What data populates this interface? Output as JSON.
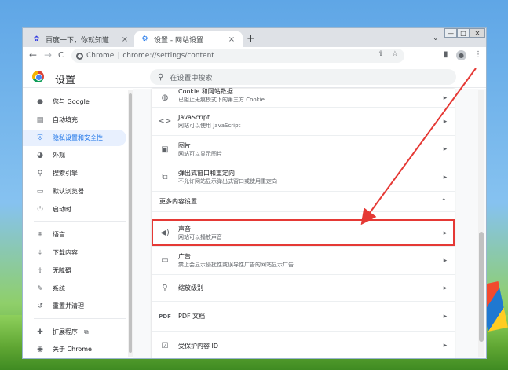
{
  "tabs": [
    {
      "title": "百度一下，你就知道",
      "close": "×"
    },
    {
      "title": "设置 - 网站设置",
      "close": "×"
    }
  ],
  "newtab": "+",
  "window_controls": {
    "minimize": "—",
    "maximize": "□",
    "close": "✕"
  },
  "toolbar": {
    "back": "←",
    "forward": "→",
    "reload": "C",
    "chip": "Chrome",
    "url": "chrome://settings/content"
  },
  "settings": {
    "title": "设置",
    "search_placeholder": "在设置中搜索"
  },
  "sidebar": {
    "items": [
      {
        "label": "您与 Google",
        "icon": "person-icon"
      },
      {
        "label": "自动填充",
        "icon": "clipboard-icon"
      },
      {
        "label": "隐私设置和安全性",
        "icon": "shield-icon"
      },
      {
        "label": "外观",
        "icon": "palette-icon"
      },
      {
        "label": "搜索引擎",
        "icon": "search-icon"
      },
      {
        "label": "默认浏览器",
        "icon": "browser-icon"
      },
      {
        "label": "启动时",
        "icon": "power-icon"
      },
      {
        "label": "语言",
        "icon": "globe-icon"
      },
      {
        "label": "下载内容",
        "icon": "download-icon"
      },
      {
        "label": "无障碍",
        "icon": "accessibility-icon"
      },
      {
        "label": "系统",
        "icon": "wrench-icon"
      },
      {
        "label": "重置并清理",
        "icon": "history-icon"
      },
      {
        "label": "扩展程序",
        "icon": "puzzle-icon"
      },
      {
        "label": "关于 Chrome",
        "icon": "chrome-icon"
      }
    ],
    "active_index": 2
  },
  "content": {
    "rows_top": [
      {
        "title": "Cookie 和网站数据",
        "subtitle": "已阻止无痕模式下的第三方 Cookie",
        "icon": "cookie-icon"
      },
      {
        "title": "JavaScript",
        "subtitle": "网站可以使用 JavaScript",
        "icon": "code-icon"
      },
      {
        "title": "图片",
        "subtitle": "网站可以显示图片",
        "icon": "image-icon"
      },
      {
        "title": "弹出式窗口和重定向",
        "subtitle": "不允许网站显示弹出式窗口或使用重定向",
        "icon": "popup-icon"
      }
    ],
    "section_title": "更多内容设置",
    "rows_more": [
      {
        "title": "声音",
        "subtitle": "网站可以播放声音",
        "icon": "speaker-icon"
      },
      {
        "title": "广告",
        "subtitle": "禁止会显示侵扰性或误导性广告的网站显示广告",
        "icon": "ad-icon"
      },
      {
        "title": "缩放级别",
        "subtitle": "",
        "icon": "zoom-icon"
      },
      {
        "title": "PDF 文档",
        "subtitle": "",
        "icon": "pdf-icon"
      },
      {
        "title": "受保护内容 ID",
        "subtitle": "",
        "icon": "protected-content-icon"
      }
    ]
  },
  "colors": {
    "accent": "#1a73e8",
    "highlight_box": "#e53935",
    "annotation_arrow": "#e53935"
  }
}
